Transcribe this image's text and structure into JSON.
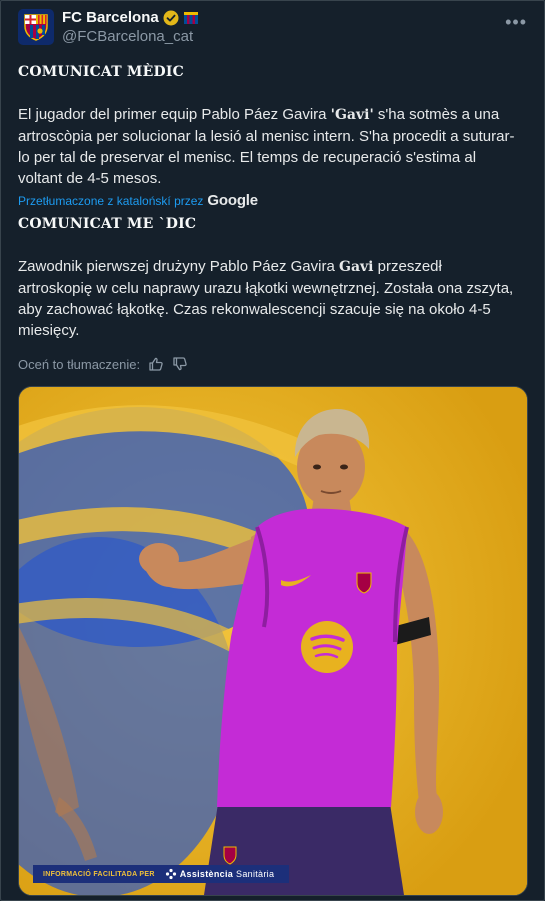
{
  "tweet": {
    "author_name": "FC Barcelona",
    "author_handle": "@FCBarcelona_cat",
    "more_label": "•••",
    "original": {
      "heading": "COMUNICAT MÈDIC",
      "text_before": "El jugador del primer equip Pablo Páez Gavira ",
      "text_gavi": "'Gavi'",
      "text_after": " s'ha sotmès a una artroscòpia per solucionar la lesió al menisc intern. S'ha procedit a suturar-lo per tal de preservar el menisc. El temps de recuperació s'estima al voltant de 4-5 mesos."
    },
    "translation_note": "Przetłumaczone z katalońskí przez",
    "translation_provider": "Google",
    "translated": {
      "heading": "COMUNICAT ME `DIC",
      "text_before": "Zawodnik pierwszej drużyny Pablo Páez Gavira ",
      "text_gavi": "Gavi",
      "text_after": " przeszedł artroskopię w celu naprawy urazu łąkotki wewnętrznej. Została ona zszyta, aby zachować łąkotkę. Czas rekonwalescencji szacuje się na około 4-5 miesięcy."
    },
    "rate_label": "Oceń to tłumaczenie:",
    "media": {
      "banner_left": "INFORMACIÓ FACILITADA PER",
      "banner_brand_a": "Assistència",
      "banner_brand_b": "Sanitària"
    }
  },
  "colors": {
    "background": "#15202b",
    "accent": "#1d9bf0",
    "muted": "#8b98a5",
    "verified": "#e2b719",
    "shirt": "#c42bd6"
  },
  "icons": [
    "verified-badge-icon",
    "club-flag-icon",
    "more-icon",
    "thumbs-up-icon",
    "thumbs-down-icon"
  ]
}
